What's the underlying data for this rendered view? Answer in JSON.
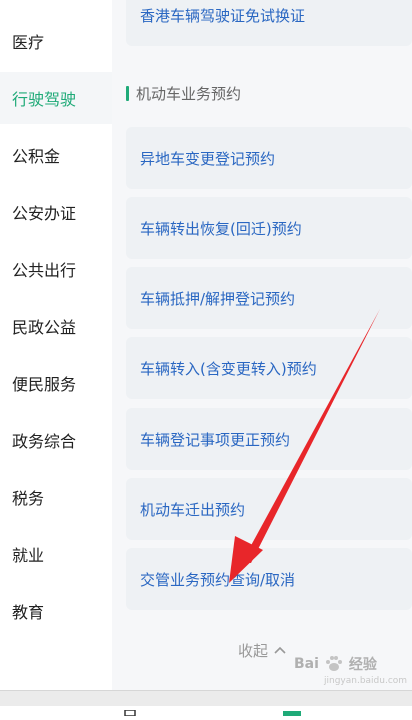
{
  "sidebar": {
    "items": [
      {
        "label": "医疗",
        "active": false
      },
      {
        "label": "行驶驾驶",
        "active": true
      },
      {
        "label": "公积金",
        "active": false
      },
      {
        "label": "公安办证",
        "active": false
      },
      {
        "label": "公共出行",
        "active": false
      },
      {
        "label": "民政公益",
        "active": false
      },
      {
        "label": "便民服务",
        "active": false
      },
      {
        "label": "政务综合",
        "active": false
      },
      {
        "label": "税务",
        "active": false
      },
      {
        "label": "就业",
        "active": false
      },
      {
        "label": "教育",
        "active": false
      }
    ]
  },
  "content": {
    "prev_item": "香港车辆驾驶证免试换证",
    "section_title": "机动车业务预约",
    "items": [
      "异地车变更登记预约",
      "车辆转出恢复(回迁)预约",
      "车辆抵押/解押登记预约",
      "车辆转入(含变更转入)预约",
      "车辆登记事项更正预约",
      "机动车迁出预约",
      "交管业务预约查询/取消"
    ],
    "collapse_label": "收起"
  },
  "watermark": {
    "brand": "Bai",
    "brand2": "经验",
    "sub": "jingyan.baidu.com"
  },
  "colors": {
    "accent": "#1faa78",
    "link": "#2a67c2",
    "arrow": "#e8262a"
  }
}
